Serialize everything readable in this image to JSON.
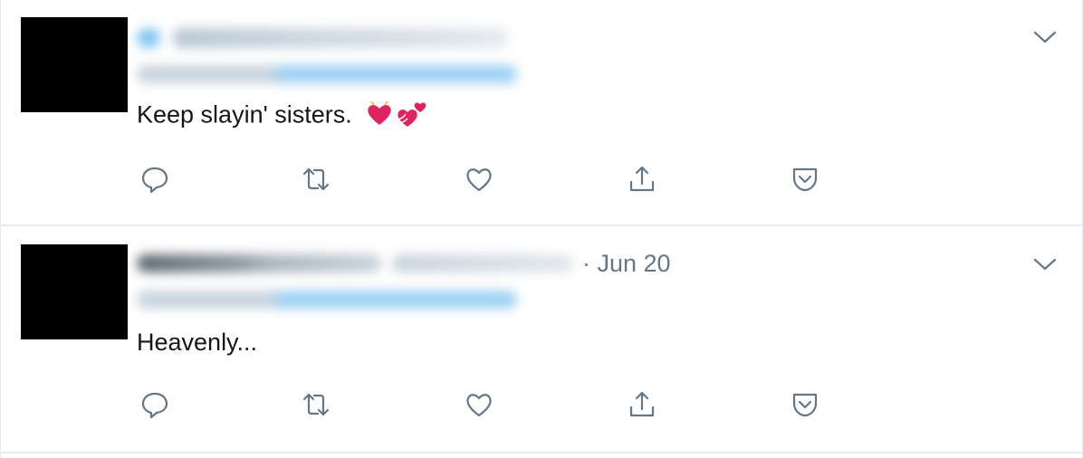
{
  "tweets": [
    {
      "date": "",
      "text": "Keep slayin' sisters. ",
      "emoji": [
        "heart-icon",
        "two-hearts-icon"
      ]
    },
    {
      "date": "· Jun 20",
      "text": "Heavenly..."
    }
  ],
  "actions": [
    "reply-icon",
    "retweet-icon",
    "like-icon",
    "share-icon",
    "pocket-icon"
  ],
  "colors": {
    "icon": "#657786",
    "border": "#e6ecf0",
    "text": "#14171a",
    "heart": "#e0245e"
  }
}
